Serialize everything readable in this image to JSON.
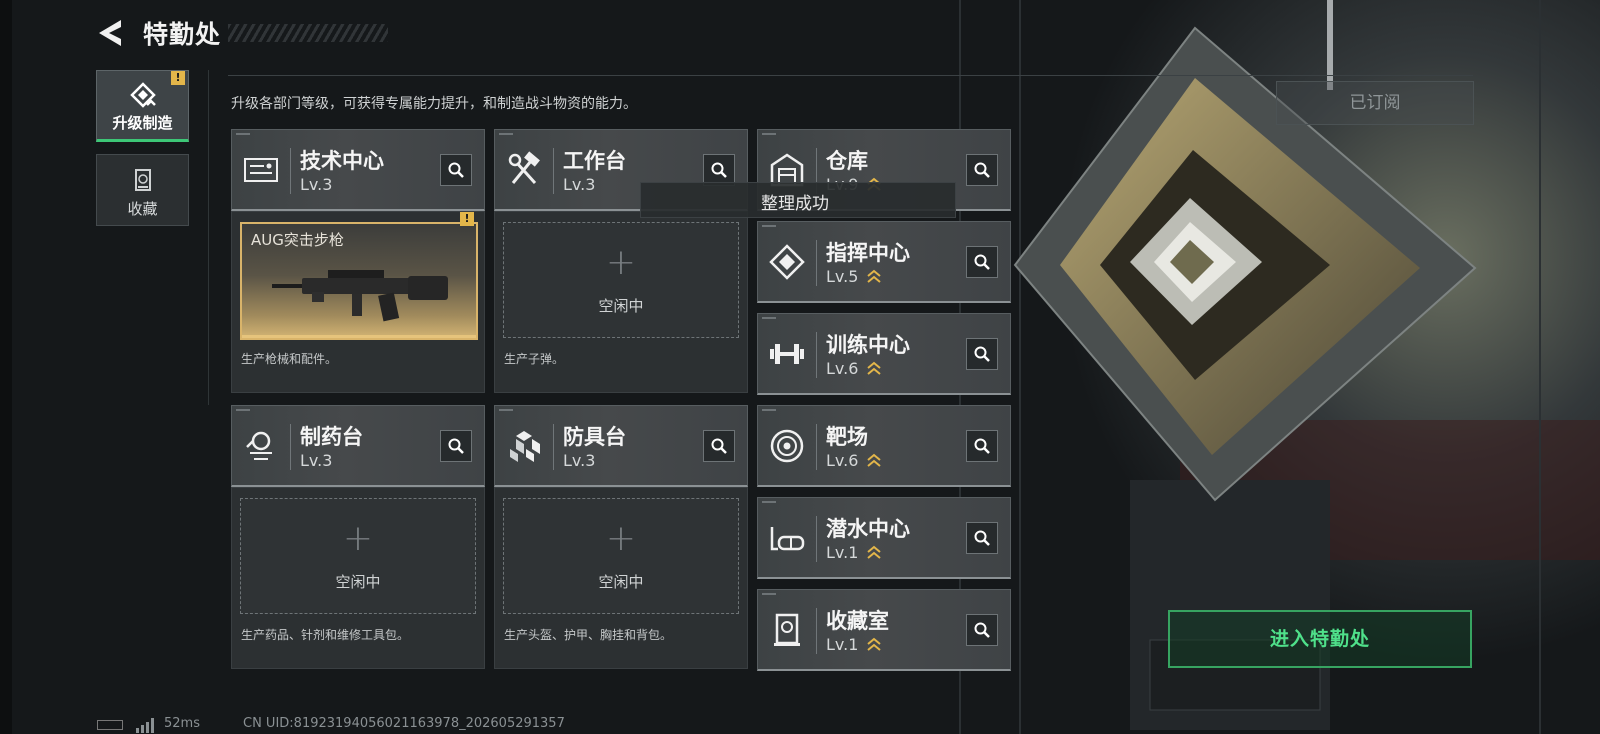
{
  "header": {
    "title": "特勤处"
  },
  "sidebar": {
    "tabs": [
      {
        "label": "升级制造",
        "icon": "upgrade-icon",
        "active": true,
        "badge": "!"
      },
      {
        "label": "收藏",
        "icon": "collection-icon",
        "active": false
      }
    ]
  },
  "main": {
    "subtitle": "升级各部门等级，可获得专属能力提升，和制造战斗物资的能力。",
    "subscribed_label": "已订阅",
    "departments": [
      {
        "name": "技术中心",
        "level": "Lv.3",
        "icon": "tech-center-icon",
        "upgradable": false
      },
      {
        "name": "工作台",
        "level": "Lv.3",
        "icon": "workbench-icon",
        "upgradable": false
      },
      {
        "name": "仓库",
        "level": "Lv.9",
        "icon": "warehouse-icon",
        "upgradable": true
      },
      {
        "name": "指挥中心",
        "level": "Lv.5",
        "icon": "command-center-icon",
        "upgradable": true
      },
      {
        "name": "训练中心",
        "level": "Lv.6",
        "icon": "training-center-icon",
        "upgradable": true
      },
      {
        "name": "制药台",
        "level": "Lv.3",
        "icon": "pharmacy-icon",
        "upgradable": false
      },
      {
        "name": "防具台",
        "level": "Lv.3",
        "icon": "armor-bench-icon",
        "upgradable": false
      },
      {
        "name": "靶场",
        "level": "Lv.6",
        "icon": "shooting-range-icon",
        "upgradable": true
      },
      {
        "name": "潜水中心",
        "level": "Lv.1",
        "icon": "diving-center-icon",
        "upgradable": true
      },
      {
        "name": "收藏室",
        "level": "Lv.1",
        "icon": "collection-room-icon",
        "upgradable": true
      }
    ],
    "production": [
      {
        "item": "AUG突击步枪",
        "desc": "生产枪械和配件。",
        "badge": "!"
      },
      {
        "status": "空闲中",
        "desc": "生产子弹。"
      },
      {
        "status": "空闲中",
        "desc": "生产药品、针剂和维修工具包。"
      },
      {
        "status": "空闲中",
        "desc": "生产头盔、护甲、胸挂和背包。"
      }
    ]
  },
  "toast": "整理成功",
  "enter_button": "进入特勤处",
  "footer": {
    "ping": "52ms",
    "uid": "CN UID:81923194056021163978_202605291357"
  },
  "colors": {
    "accent": "#3dc777",
    "gold": "#d9b46a",
    "badge": "#e3b64a"
  }
}
